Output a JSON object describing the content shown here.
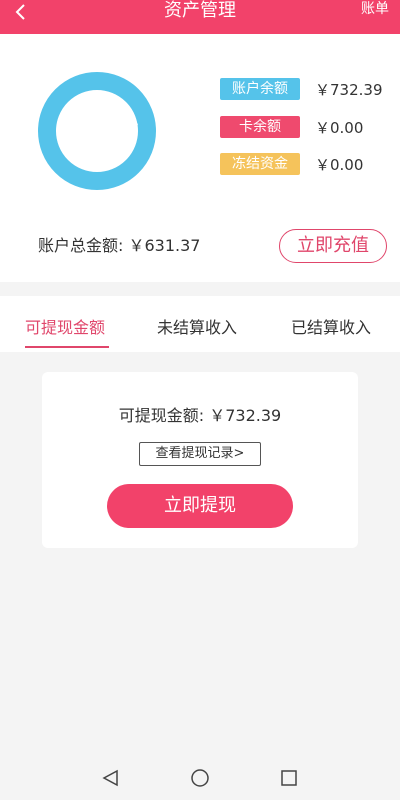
{
  "header": {
    "title": "资产管理",
    "right_label": "账单"
  },
  "summary": {
    "legend": [
      {
        "label": "账户余额",
        "value": "￥732.39",
        "color": "#55c3ea"
      },
      {
        "label": "卡余额",
        "value": "￥0.00",
        "color": "#ef4a6e"
      },
      {
        "label": "冻结资金",
        "value": "￥0.00",
        "color": "#f5c35b"
      }
    ],
    "total_label": "账户总金额: ￥631.37",
    "recharge_label": "立即充值"
  },
  "tabs": [
    {
      "label": "可提现金额",
      "active": true
    },
    {
      "label": "未结算收入",
      "active": false
    },
    {
      "label": "已结算收入",
      "active": false
    }
  ],
  "card": {
    "amount_label": "可提现金额: ￥732.39",
    "history_label": "查看提现记录>",
    "withdraw_label": "立即提现"
  },
  "colors": {
    "brand": "#f2426a",
    "accent": "#e0466b",
    "donut": "#55c3ea"
  }
}
